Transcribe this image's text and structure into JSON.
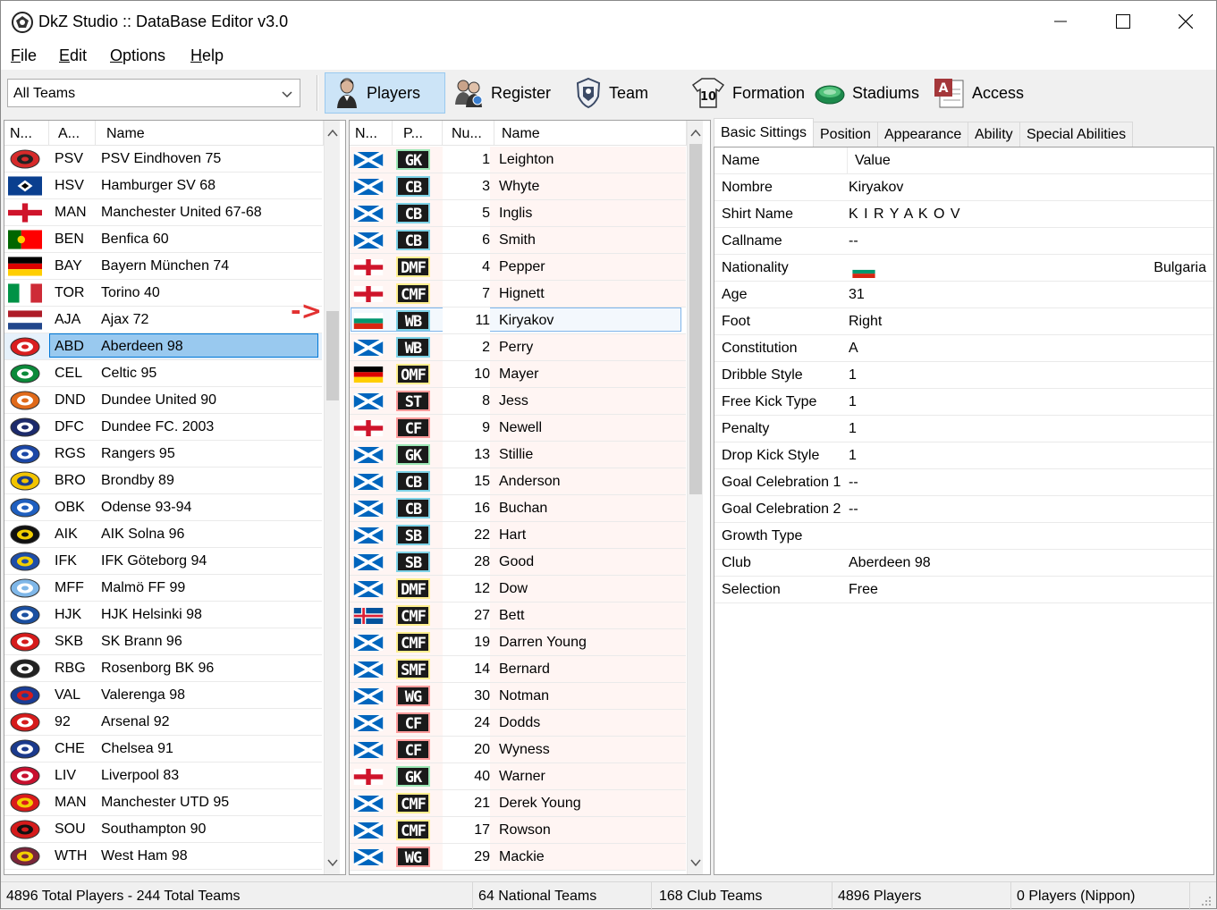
{
  "window": {
    "title": "DkZ Studio :: DataBase Editor v3.0"
  },
  "menu": {
    "file": "File",
    "edit": "Edit",
    "options": "Options",
    "help": "Help"
  },
  "toolbar": {
    "team_filter": "All Teams",
    "players": "Players",
    "register": "Register",
    "team": "Team",
    "formation": "Formation",
    "stadiums": "Stadiums",
    "access": "Access"
  },
  "teams_table": {
    "headers": [
      "N...",
      "A...",
      "Name"
    ],
    "rows": [
      {
        "abbr": "PSV",
        "name": "PSV Eindhoven 75",
        "crest": "psv-crest"
      },
      {
        "abbr": "HSV",
        "name": "Hamburger SV 68",
        "crest": "hsv-crest"
      },
      {
        "abbr": "MAN",
        "name": "Manchester United 67-68",
        "crest": "england-flag"
      },
      {
        "abbr": "BEN",
        "name": "Benfica 60",
        "crest": "portugal-flag"
      },
      {
        "abbr": "BAY",
        "name": "Bayern München 74",
        "crest": "germany-flag"
      },
      {
        "abbr": "TOR",
        "name": "Torino 40",
        "crest": "italy-flag"
      },
      {
        "abbr": "AJA",
        "name": "Ajax 72",
        "crest": "netherlands-flag"
      },
      {
        "abbr": "ABD",
        "name": "Aberdeen 98",
        "crest": "aberdeen-crest"
      },
      {
        "abbr": "CEL",
        "name": "Celtic 95",
        "crest": "celtic-crest"
      },
      {
        "abbr": "DND",
        "name": "Dundee United 90",
        "crest": "dundee-united-crest"
      },
      {
        "abbr": "DFC",
        "name": "Dundee FC. 2003",
        "crest": "dundee-crest"
      },
      {
        "abbr": "RGS",
        "name": "Rangers 95",
        "crest": "rangers-crest"
      },
      {
        "abbr": "BRO",
        "name": "Brondby 89",
        "crest": "brondby-crest"
      },
      {
        "abbr": "OBK",
        "name": "Odense 93-94",
        "crest": "odense-crest"
      },
      {
        "abbr": "AIK",
        "name": "AIK Solna 96",
        "crest": "aik-crest"
      },
      {
        "abbr": "IFK",
        "name": "IFK Göteborg 94",
        "crest": "ifk-crest"
      },
      {
        "abbr": "MFF",
        "name": "Malmö FF 99",
        "crest": "malmo-crest"
      },
      {
        "abbr": "HJK",
        "name": "HJK Helsinki 98",
        "crest": "hjk-crest"
      },
      {
        "abbr": "SKB",
        "name": "SK Brann 96",
        "crest": "brann-crest"
      },
      {
        "abbr": "RBG",
        "name": "Rosenborg BK 96",
        "crest": "rosenborg-crest"
      },
      {
        "abbr": "VAL",
        "name": "Valerenga 98",
        "crest": "valerenga-crest"
      },
      {
        "abbr": "92",
        "name": "Arsenal 92",
        "crest": "arsenal-crest"
      },
      {
        "abbr": "CHE",
        "name": "Chelsea 91",
        "crest": "chelsea-crest"
      },
      {
        "abbr": "LIV",
        "name": "Liverpool 83",
        "crest": "liverpool-crest"
      },
      {
        "abbr": "MAN",
        "name": "Manchester UTD 95",
        "crest": "manutd-crest"
      },
      {
        "abbr": "SOU",
        "name": "Southampton 90",
        "crest": "southampton-crest"
      },
      {
        "abbr": "WTH",
        "name": "West Ham 98",
        "crest": "westham-crest"
      }
    ],
    "selected_index": 7,
    "scroll_position": 0.27
  },
  "arrow_marker": "->",
  "players_table": {
    "headers": [
      "N...",
      "P...",
      "Nu...",
      "Name"
    ],
    "rows": [
      {
        "flag": "scotland",
        "pos": "GK",
        "num": "1",
        "name": "Leighton"
      },
      {
        "flag": "scotland",
        "pos": "CB",
        "num": "3",
        "name": "Whyte"
      },
      {
        "flag": "scotland",
        "pos": "CB",
        "num": "5",
        "name": "Inglis"
      },
      {
        "flag": "scotland",
        "pos": "CB",
        "num": "6",
        "name": "Smith"
      },
      {
        "flag": "england",
        "pos": "DMF",
        "num": "4",
        "name": "Pepper"
      },
      {
        "flag": "england",
        "pos": "CMF",
        "num": "7",
        "name": "Hignett"
      },
      {
        "flag": "bulgaria",
        "pos": "WB",
        "num": "11",
        "name": "Kiryakov"
      },
      {
        "flag": "scotland",
        "pos": "WB",
        "num": "2",
        "name": "Perry"
      },
      {
        "flag": "germany",
        "pos": "OMF",
        "num": "10",
        "name": "Mayer"
      },
      {
        "flag": "scotland",
        "pos": "ST",
        "num": "8",
        "name": "Jess"
      },
      {
        "flag": "england",
        "pos": "CF",
        "num": "9",
        "name": "Newell"
      },
      {
        "flag": "scotland",
        "pos": "GK",
        "num": "13",
        "name": "Stillie"
      },
      {
        "flag": "scotland",
        "pos": "CB",
        "num": "15",
        "name": "Anderson"
      },
      {
        "flag": "scotland",
        "pos": "CB",
        "num": "16",
        "name": "Buchan"
      },
      {
        "flag": "scotland",
        "pos": "SB",
        "num": "22",
        "name": "Hart"
      },
      {
        "flag": "scotland",
        "pos": "SB",
        "num": "28",
        "name": "Good"
      },
      {
        "flag": "scotland",
        "pos": "DMF",
        "num": "12",
        "name": "Dow"
      },
      {
        "flag": "iceland",
        "pos": "CMF",
        "num": "27",
        "name": "Bett"
      },
      {
        "flag": "scotland",
        "pos": "CMF",
        "num": "19",
        "name": "Darren Young"
      },
      {
        "flag": "scotland",
        "pos": "SMF",
        "num": "14",
        "name": "Bernard"
      },
      {
        "flag": "scotland",
        "pos": "WG",
        "num": "30",
        "name": "Notman"
      },
      {
        "flag": "scotland",
        "pos": "CF",
        "num": "24",
        "name": "Dodds"
      },
      {
        "flag": "scotland",
        "pos": "CF",
        "num": "20",
        "name": "Wyness"
      },
      {
        "flag": "england",
        "pos": "GK",
        "num": "40",
        "name": "Warner"
      },
      {
        "flag": "scotland",
        "pos": "CMF",
        "num": "21",
        "name": "Derek Young"
      },
      {
        "flag": "scotland",
        "pos": "CMF",
        "num": "17",
        "name": "Rowson"
      },
      {
        "flag": "scotland",
        "pos": "WG",
        "num": "29",
        "name": "Mackie"
      }
    ],
    "selected_index": 6
  },
  "detail_tabs": [
    "Basic Sittings",
    "Position",
    "Appearance",
    "Ability",
    "Special Abilities"
  ],
  "properties": {
    "headers": [
      "Name",
      "Value"
    ],
    "rows": [
      {
        "name": "Nombre",
        "value": "Kiryakov"
      },
      {
        "name": "Shirt Name",
        "value": "K I R Y A K O V"
      },
      {
        "name": "Callname",
        "value": "--"
      },
      {
        "name": "Nationality",
        "value": "Bulgaria",
        "flag": "bulgaria"
      },
      {
        "name": "Age",
        "value": "31"
      },
      {
        "name": "Foot",
        "value": "Right"
      },
      {
        "name": "Constitution",
        "value": "A"
      },
      {
        "name": "Dribble Style",
        "value": "1"
      },
      {
        "name": "Free Kick Type",
        "value": "1"
      },
      {
        "name": "Penalty",
        "value": "1"
      },
      {
        "name": "Drop Kick Style",
        "value": "1"
      },
      {
        "name": "Goal Celebration 1",
        "value": "--"
      },
      {
        "name": "Goal Celebration 2",
        "value": "--"
      },
      {
        "name": "Growth Type",
        "value": ""
      },
      {
        "name": "Club",
        "value": "Aberdeen 98"
      },
      {
        "name": "Selection",
        "value": "Free"
      }
    ]
  },
  "status": {
    "totals": "4896 Total Players  -  244 Total Teams",
    "national": "64 National Teams",
    "club": "168 Club Teams",
    "players": "4896 Players",
    "nippon": "0 Players (Nippon)"
  },
  "colors": {
    "selection": "#99c9ef",
    "selection_border": "#0078d7",
    "player_row_tint": "#fff5f3",
    "arrow": "#e23131"
  }
}
